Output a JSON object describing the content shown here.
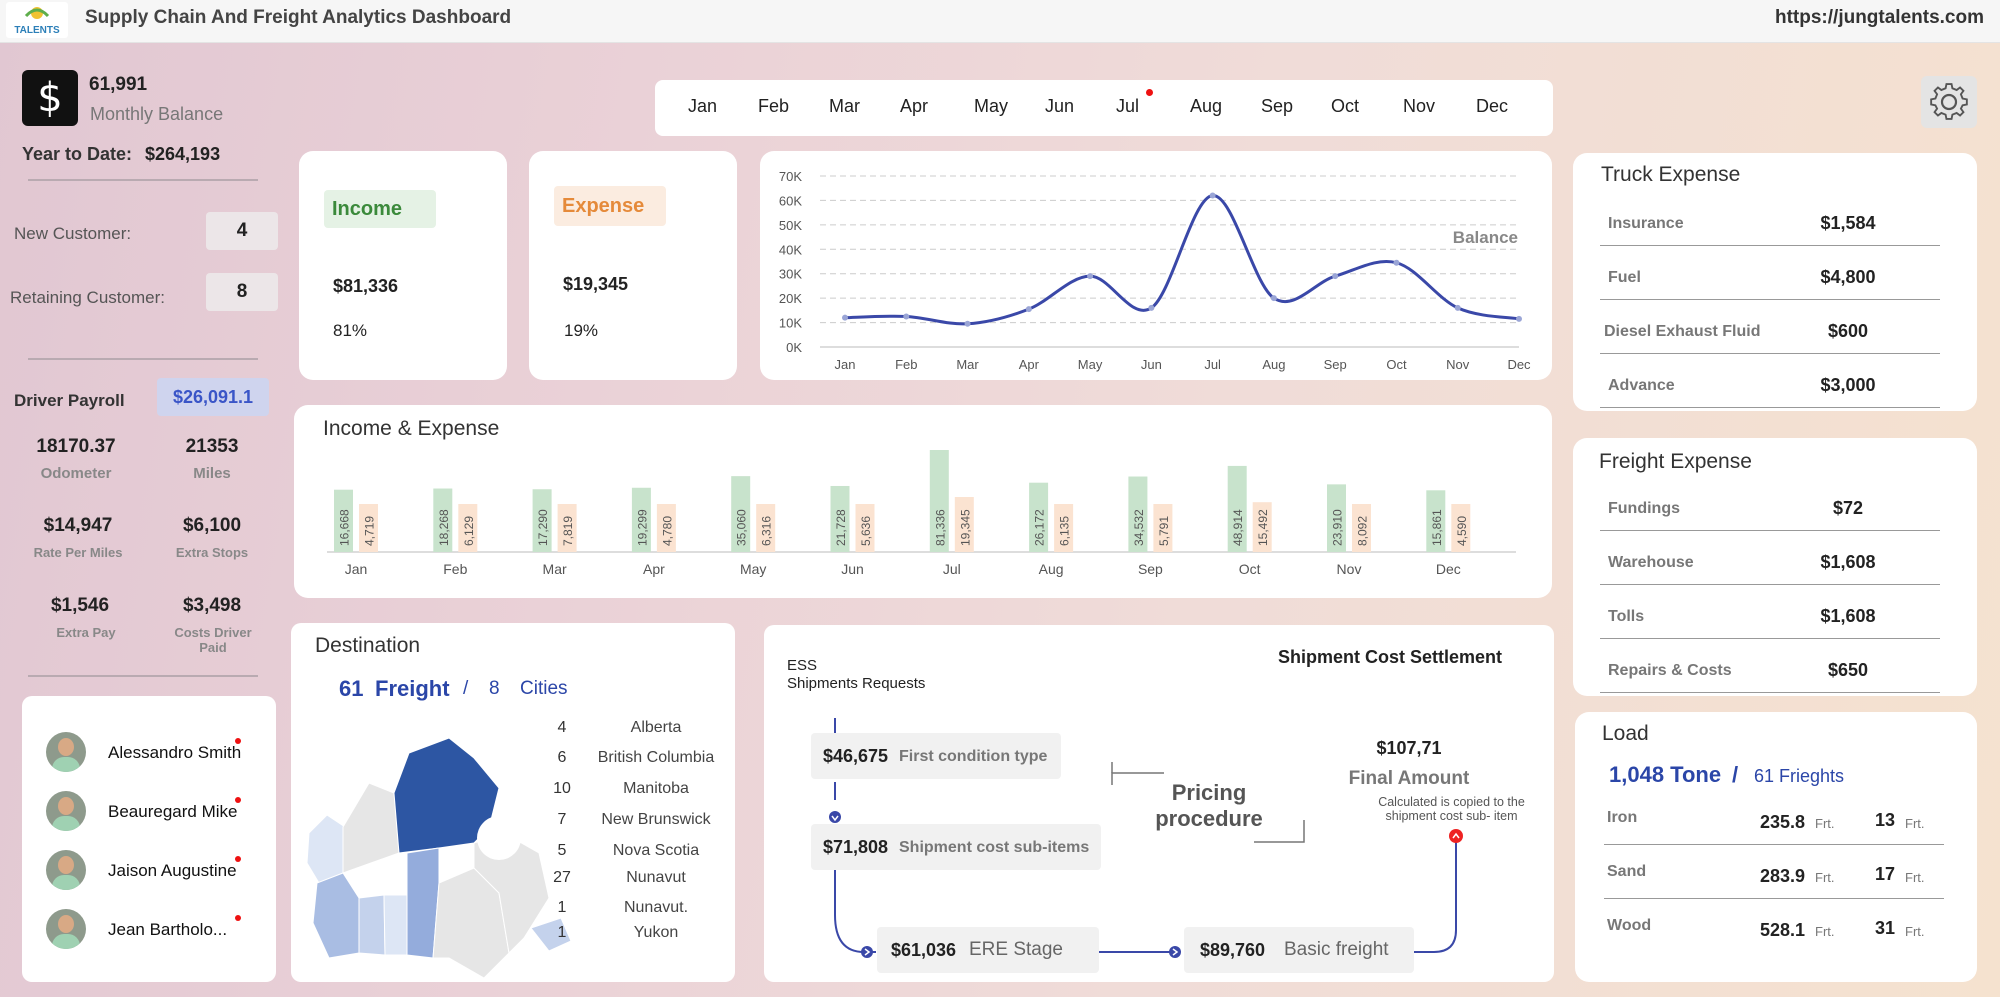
{
  "header": {
    "title": "Supply Chain And Freight Analytics Dashboard",
    "url": "https://jungtalents.com",
    "logo_text": "TALENTS"
  },
  "balance": {
    "value": "61,991",
    "label": "Monthly Balance",
    "ytd_label": "Year to Date:",
    "ytd_value": "$264,193"
  },
  "customers": {
    "new_label": "New Customer:",
    "new_value": "4",
    "retaining_label": "Retaining Customer:",
    "retaining_value": "8"
  },
  "payroll": {
    "label": "Driver Payroll",
    "value": "$26,091.1",
    "stats": [
      {
        "value": "18170.37",
        "label": "Odometer"
      },
      {
        "value": "21353",
        "label": "Miles"
      },
      {
        "value": "$14,947",
        "label": "Rate Per Miles"
      },
      {
        "value": "$6,100",
        "label": "Extra Stops"
      },
      {
        "value": "$1,546",
        "label": "Extra Pay"
      },
      {
        "value": "$3,498",
        "label": "Costs Driver Paid"
      }
    ]
  },
  "drivers": [
    "Alessandro Smith",
    "Beauregard Mike",
    "Jaison Augustine",
    "Jean Bartholo..."
  ],
  "months": [
    "Jan",
    "Feb",
    "Mar",
    "Apr",
    "May",
    "Jun",
    "Jul",
    "Aug",
    "Sep",
    "Oct",
    "Nov",
    "Dec"
  ],
  "income": {
    "label": "Income",
    "value": "$81,336",
    "pct": "81%"
  },
  "expense": {
    "label": "Expense",
    "value": "$19,345",
    "pct": "19%"
  },
  "colors": {
    "income_bar": "#c8e3cc",
    "expense_bar": "#fbe3d1",
    "line": "#3a48a8",
    "accent_blue": "#2b46a8",
    "map_dark": "#2d56a3"
  },
  "chart_data": [
    {
      "type": "line",
      "series": [
        {
          "name": "Balance",
          "values": [
            12000,
            12500,
            9500,
            15500,
            29000,
            16000,
            62000,
            20000,
            29000,
            34500,
            16000,
            11500
          ]
        }
      ],
      "categories": [
        "Jan",
        "Feb",
        "Mar",
        "Apr",
        "May",
        "Jun",
        "Jul",
        "Aug",
        "Sep",
        "Oct",
        "Nov",
        "Dec"
      ],
      "ylim": [
        0,
        70000
      ],
      "yticks": [
        "0K",
        "10K",
        "20K",
        "30K",
        "40K",
        "50K",
        "60K",
        "70K"
      ],
      "grid": true
    },
    {
      "type": "bar",
      "title": "Income & Expense",
      "categories": [
        "Jan",
        "Feb",
        "Mar",
        "Apr",
        "May",
        "Jun",
        "Jul",
        "Aug",
        "Sep",
        "Oct",
        "Nov",
        "Dec"
      ],
      "series": [
        {
          "name": "Income",
          "values": [
            16668,
            18268,
            17290,
            19299,
            35060,
            21728,
            81336,
            26172,
            34532,
            48914,
            23910,
            15861
          ],
          "labels": [
            "16,668",
            "18,268",
            "17,290",
            "19,299",
            "35,060",
            "21,728",
            "81,336",
            "26,172",
            "34,532",
            "48,914",
            "23,910",
            "15,861"
          ]
        },
        {
          "name": "Expense",
          "values": [
            4719,
            6129,
            7819,
            4780,
            6316,
            5636,
            19345,
            6135,
            5791,
            15492,
            8092,
            4590
          ],
          "labels": [
            "4,719",
            "6,129",
            "7,819",
            "4,780",
            "6,316",
            "5,636",
            "19,345",
            "6,135",
            "5,791",
            "15,492",
            "8,092",
            "4,590"
          ]
        }
      ]
    }
  ],
  "truck": {
    "title": "Truck Expense",
    "items": [
      {
        "label": "Insurance",
        "value": "$1,584"
      },
      {
        "label": "Fuel",
        "value": "$4,800"
      },
      {
        "label": "Diesel Exhaust Fluid",
        "value": "$600"
      },
      {
        "label": "Advance",
        "value": "$3,000"
      }
    ]
  },
  "freight": {
    "title": "Freight Expense",
    "items": [
      {
        "label": "Fundings",
        "value": "$72"
      },
      {
        "label": "Warehouse",
        "value": "$1,608"
      },
      {
        "label": "Tolls",
        "value": "$1,608"
      },
      {
        "label": "Repairs & Costs",
        "value": "$650"
      }
    ]
  },
  "load": {
    "title": "Load",
    "tone": "1,048 Tone",
    "slash": "/",
    "freights": "61 Frieghts",
    "unit": "Frt.",
    "items": [
      {
        "label": "Iron",
        "a": "235.8",
        "b": "13"
      },
      {
        "label": "Sand",
        "a": "283.9",
        "b": "17"
      },
      {
        "label": "Wood",
        "a": "528.1",
        "b": "31"
      }
    ]
  },
  "destination": {
    "title": "Destination",
    "freight_count": "61",
    "freight_label": "Freight",
    "slash": "/",
    "cities_count": "8",
    "cities_label": "Cities",
    "rows": [
      {
        "n": "4",
        "name": "Alberta"
      },
      {
        "n": "6",
        "name": "British Columbia"
      },
      {
        "n": "10",
        "name": "Manitoba"
      },
      {
        "n": "7",
        "name": "New Brunswick"
      },
      {
        "n": "5",
        "name": "Nova Scotia"
      },
      {
        "n": "27",
        "name": "Nunavut"
      },
      {
        "n": "1",
        "name": "Nunavut."
      },
      {
        "n": "1",
        "name": "Yukon"
      }
    ]
  },
  "settlement": {
    "title": "Shipment Cost Settlement",
    "ess": "ESS",
    "requests": "Shipments Requests",
    "steps": [
      {
        "value": "$46,675",
        "label": "First condition type"
      },
      {
        "value": "$71,808",
        "label": "Shipment cost sub-items"
      },
      {
        "value": "$61,036",
        "label": "ERE Stage"
      },
      {
        "value": "$89,760",
        "label": "Basic freight"
      }
    ],
    "pricing": "Pricing procedure",
    "final_value": "$107,71",
    "final_label": "Final Amount",
    "final_note": "Calculated is copied to the shipment cost sub- item"
  }
}
